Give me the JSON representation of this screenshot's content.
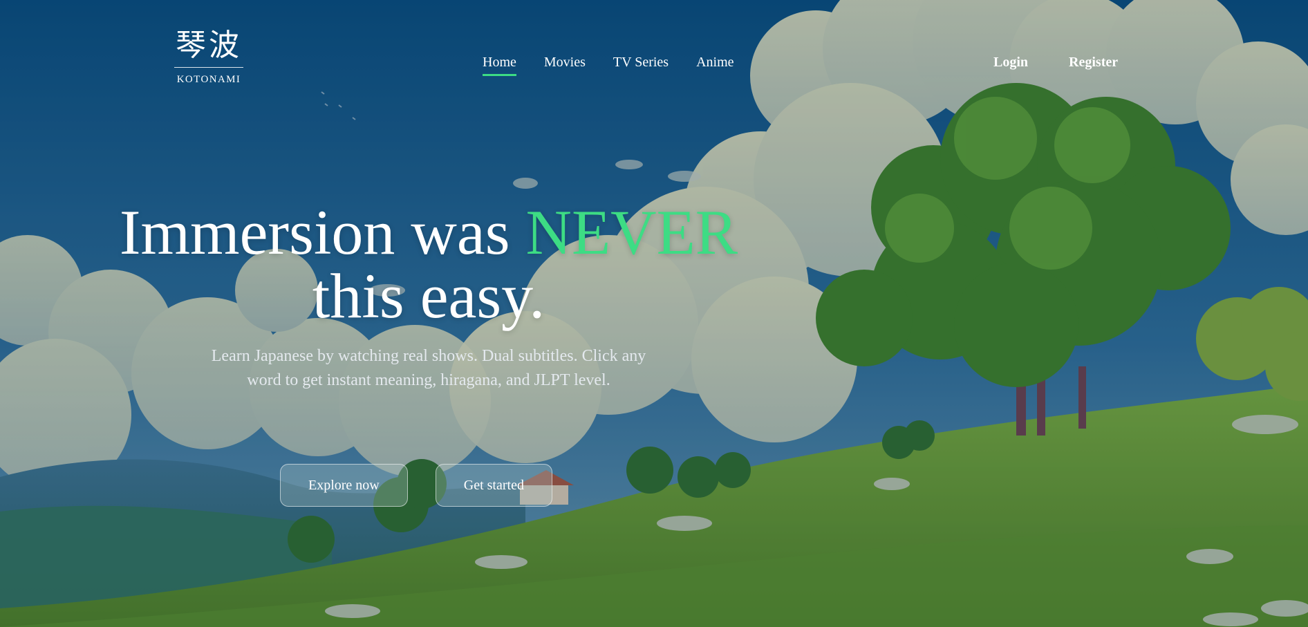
{
  "brand": {
    "kanji": "琴波",
    "name": "KOTONAMI"
  },
  "nav": [
    {
      "label": "Home",
      "active": true
    },
    {
      "label": "Movies",
      "active": false
    },
    {
      "label": "TV Series",
      "active": false
    },
    {
      "label": "Anime",
      "active": false
    }
  ],
  "auth": {
    "login": "Login",
    "register": "Register"
  },
  "hero": {
    "title_part1": "Immersion was ",
    "title_accent": "NEVER",
    "title_part2": "this easy.",
    "subtitle": "Learn Japanese by watching real shows. Dual subtitles. Click any word to get instant meaning, hiragana, and JLPT level."
  },
  "actions": {
    "explore": "Explore now",
    "get_started": "Get started"
  },
  "colors": {
    "accent": "#3ddc84",
    "sky": "#0d4f80",
    "grass": "#6a9a2c"
  }
}
